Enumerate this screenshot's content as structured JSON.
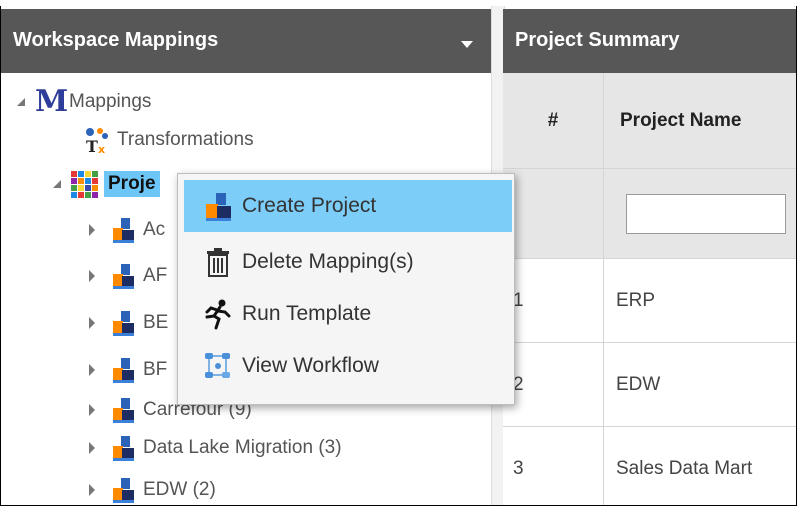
{
  "workspace": {
    "title": "Workspace Mappings",
    "tree": {
      "root": "Mappings",
      "transformations": "Transformations",
      "projects": "Proje",
      "children": [
        "Ac",
        "AF",
        "BE",
        "BF",
        "Carrefour (9)",
        "Data Lake Migration (3)",
        "EDW (2)"
      ]
    }
  },
  "context_menu": {
    "items": [
      {
        "label": "Create Project",
        "icon": "project-icon"
      },
      {
        "label": "Delete Mapping(s)",
        "icon": "trash-icon"
      },
      {
        "label": "Run Template",
        "icon": "running-man-icon"
      },
      {
        "label": "View Workflow",
        "icon": "workflow-icon"
      }
    ]
  },
  "summary": {
    "title": "Project Summary",
    "columns": [
      "#",
      "Project Name"
    ],
    "rows": [
      {
        "num": "1",
        "name": "ERP"
      },
      {
        "num": "2",
        "name": "EDW"
      },
      {
        "num": "3",
        "name": "Sales Data Mart"
      }
    ]
  },
  "colors": {
    "header_bg": "#575757",
    "selection": "#6cc6f8",
    "menu_highlight": "#7dcdf9"
  }
}
